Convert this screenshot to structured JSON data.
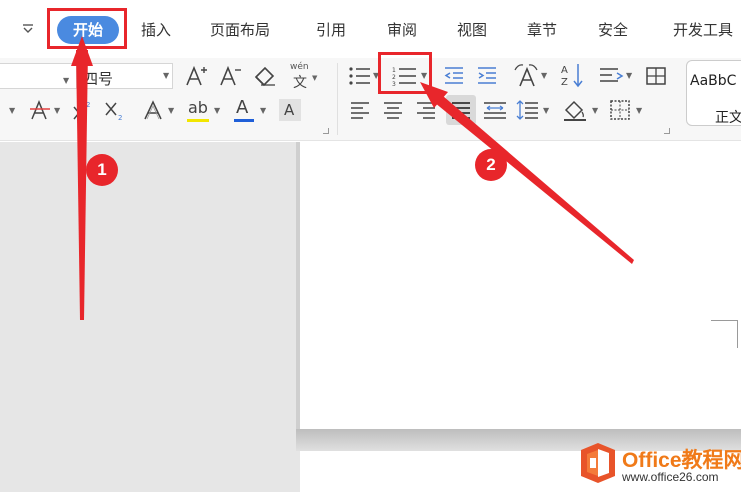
{
  "menu": {
    "chevron_icon": "chevron-down-icon",
    "tabs": [
      {
        "label": "开始",
        "active": true
      },
      {
        "label": "插入"
      },
      {
        "label": "页面布局"
      },
      {
        "label": "引用"
      },
      {
        "label": "审阅"
      },
      {
        "label": "视图"
      },
      {
        "label": "章节"
      },
      {
        "label": "安全"
      },
      {
        "label": "开发工具"
      }
    ]
  },
  "ribbon": {
    "font_size_value": "四号",
    "icons": {
      "grow_font": "increase-font-size-icon",
      "shrink_font": "decrease-font-size-icon",
      "clear_format": "clear-formatting-icon",
      "phonetic": "phonetic-guide-icon",
      "phonetic_text": "wén",
      "strikethrough": "strikethrough-icon",
      "superscript": "superscript-icon",
      "subscript": "subscript-icon",
      "text_effect": "text-effect-icon",
      "highlight": "highlight-icon",
      "font_color": "font-color-icon",
      "char_shading": "character-shading-icon",
      "bullets": "bullet-list-icon",
      "numbering": "numbered-list-icon",
      "decrease_indent": "decrease-indent-icon",
      "increase_indent": "increase-indent-icon",
      "change_case": "change-case-icon",
      "sort": "sort-icon",
      "line_spacing_tool": "paragraph-spacing-icon",
      "table_tool": "table-icon",
      "align_left": "align-left-icon",
      "align_center": "align-center-icon",
      "align_right": "align-right-icon",
      "justify": "justify-icon",
      "distribute": "distributed-align-icon",
      "line_spacing": "line-spacing-icon",
      "shading": "shading-icon",
      "borders": "borders-icon"
    },
    "style_gallery": {
      "preview": "AaBbC",
      "name": "正文"
    },
    "colors": {
      "highlight_bar": "#f2e600",
      "font_color_bar": "#1f5fd8"
    }
  },
  "annotations": {
    "step1": "1",
    "step2": "2",
    "color": "#e8262b"
  },
  "watermark": {
    "title": "Office教程网",
    "url": "www.office26.com"
  }
}
